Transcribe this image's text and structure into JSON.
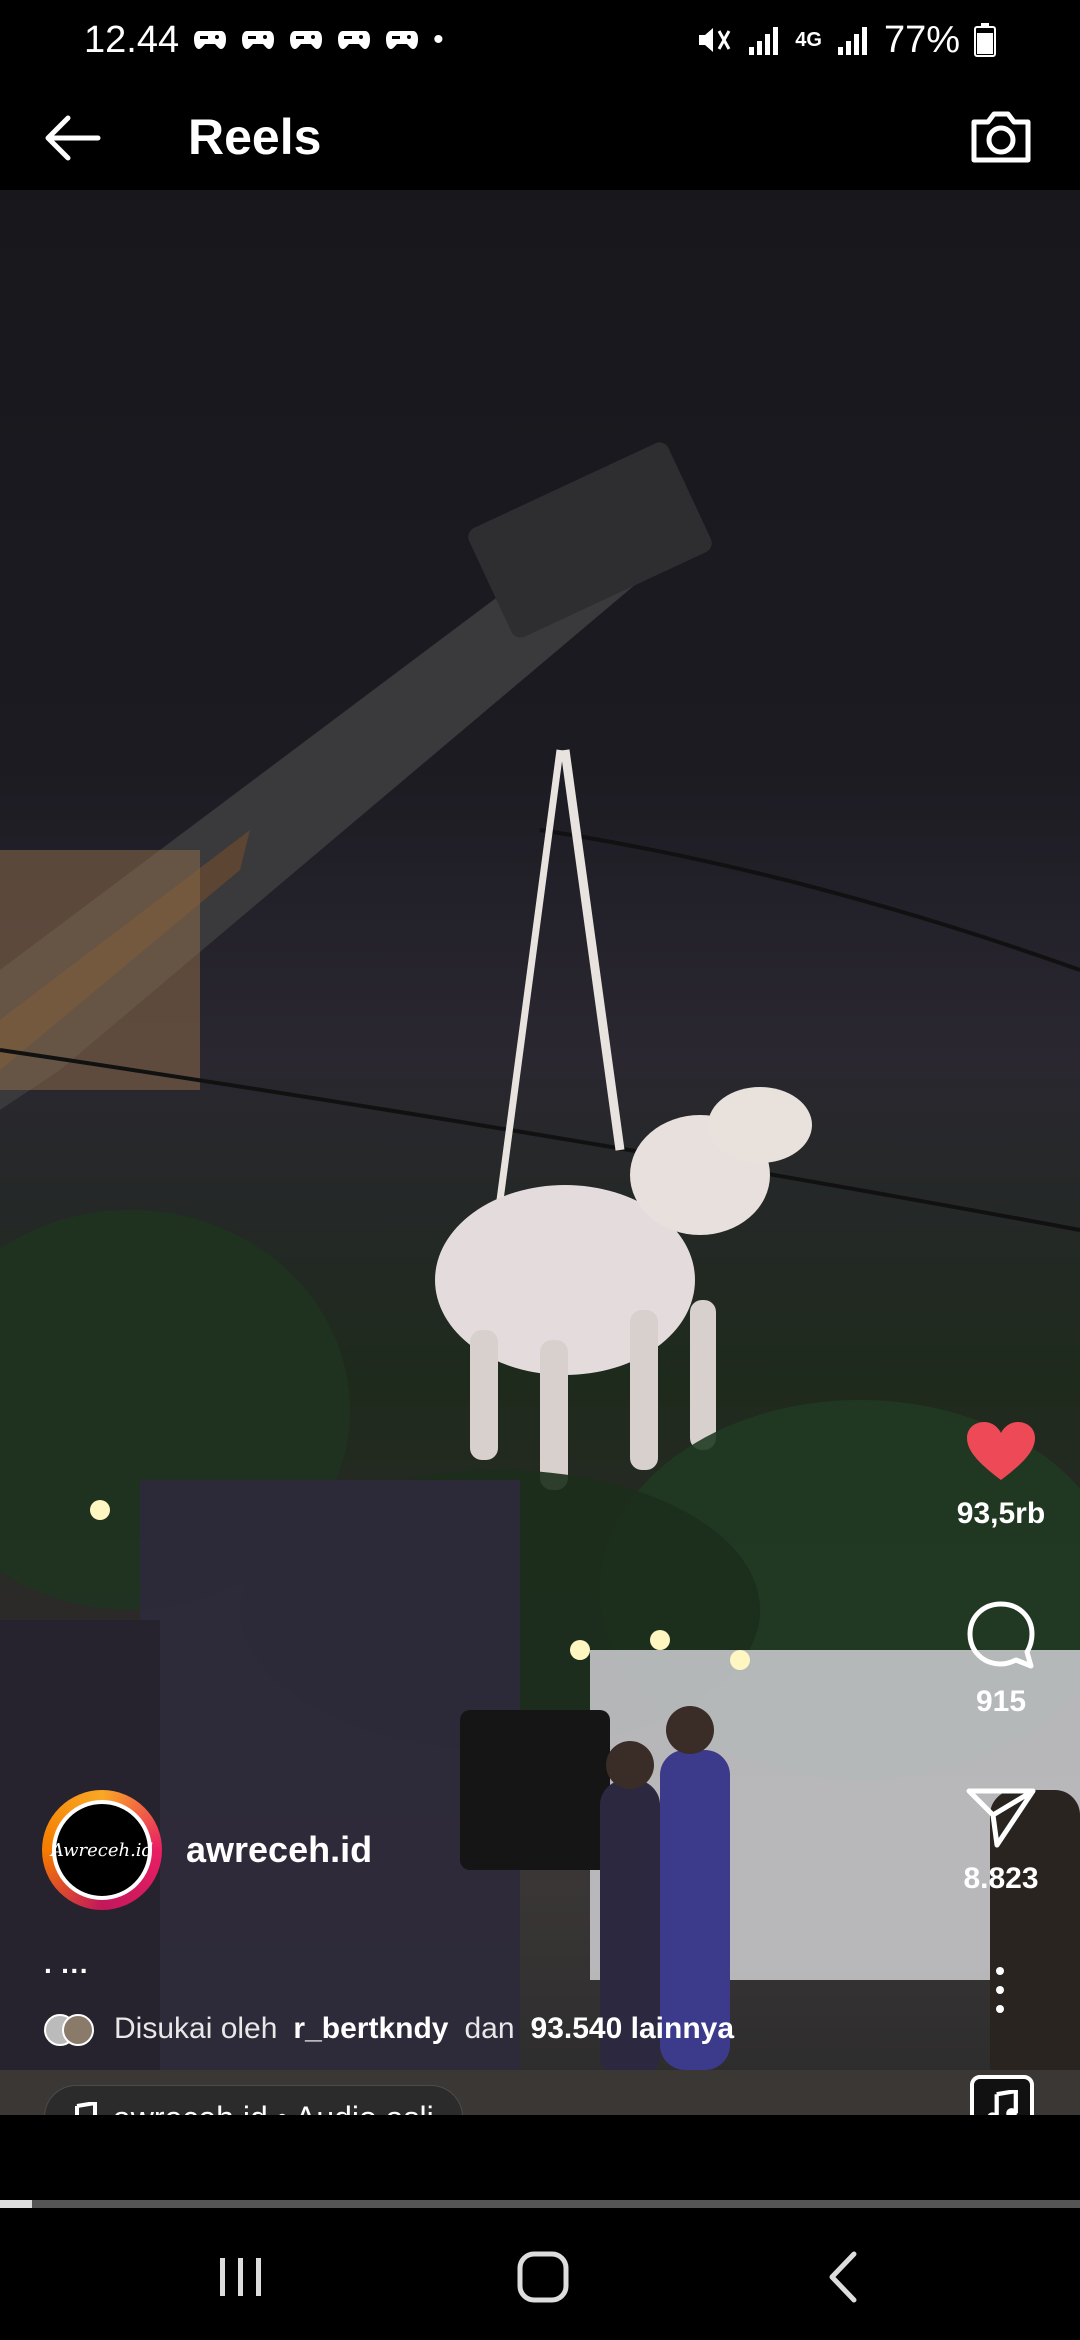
{
  "status_bar": {
    "time": "12.44",
    "battery": "77%",
    "network": "4G"
  },
  "header": {
    "title": "Reels",
    "back_icon": "arrow-left-icon",
    "camera_icon": "camera-icon"
  },
  "actions": {
    "likes": "93,5rb",
    "comments": "915",
    "shares": "8.823",
    "like_color": "#ed4956"
  },
  "author": {
    "username": "awreceh.id",
    "avatar_text": "Awreceh.id"
  },
  "caption": {
    "dots": "· ···"
  },
  "liked_by": {
    "prefix": "Disukai oleh",
    "user": "r_bertkndy",
    "middle": "dan",
    "count": "93.540 lainnya"
  },
  "audio": {
    "label": "awreceh.id • Audio asli"
  },
  "video_progress": 0.03
}
